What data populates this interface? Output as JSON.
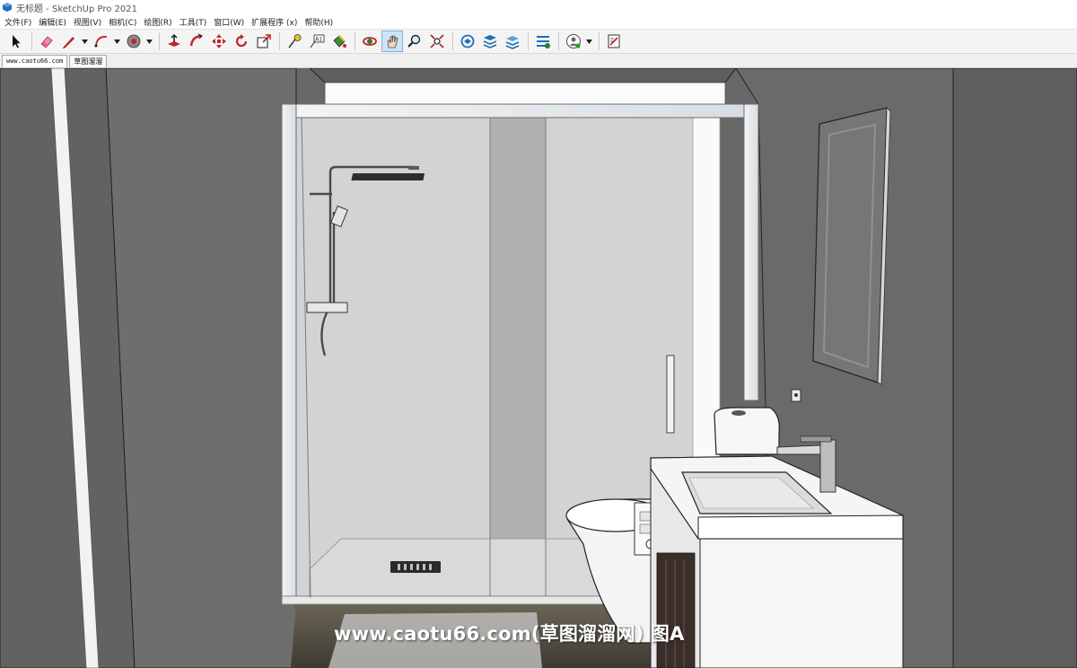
{
  "window": {
    "title": "无标题 - SketchUp Pro 2021"
  },
  "menu": {
    "items": [
      {
        "label": "文件(F)"
      },
      {
        "label": "编辑(E)"
      },
      {
        "label": "视图(V)"
      },
      {
        "label": "相机(C)"
      },
      {
        "label": "绘图(R)"
      },
      {
        "label": "工具(T)"
      },
      {
        "label": "窗口(W)"
      },
      {
        "label": "扩展程序 (x)"
      },
      {
        "label": "帮助(H)"
      }
    ]
  },
  "toolbar": {
    "tools": [
      {
        "icon": "select-arrow-icon"
      },
      {
        "icon": "eraser-icon"
      },
      {
        "icon": "pencil-line-icon"
      },
      {
        "icon": "arc-icon"
      },
      {
        "icon": "paint-bucket-icon"
      },
      {
        "icon": "push-pull-icon"
      },
      {
        "icon": "follow-me-icon"
      },
      {
        "icon": "move-icon"
      },
      {
        "icon": "rotate-icon"
      },
      {
        "icon": "scale-icon"
      },
      {
        "icon": "tape-measure-icon"
      },
      {
        "icon": "text-label-icon"
      },
      {
        "icon": "paint-icon"
      },
      {
        "icon": "orbit-icon"
      },
      {
        "icon": "pan-hand-icon"
      },
      {
        "icon": "zoom-icon"
      },
      {
        "icon": "zoom-extents-icon"
      },
      {
        "icon": "warehouse-icon"
      },
      {
        "icon": "extension-warehouse-icon"
      },
      {
        "icon": "layout-icon"
      },
      {
        "icon": "extension-manager-icon"
      },
      {
        "icon": "user-account-icon"
      },
      {
        "icon": "send-to-layout-icon"
      }
    ],
    "active_tool": "pan-hand-icon"
  },
  "scene_tabs": [
    {
      "label": "www.caotu66.com"
    },
    {
      "label": "草图溜溜"
    }
  ],
  "viewport": {
    "watermark": "www.caotu66.com(草图溜溜网) 图A"
  },
  "colors": {
    "wall": "#6a6a6a",
    "shower_panel": "#d2d2d2",
    "frame": "#e8edf0",
    "active_tool_bg": "#cde3f7",
    "accent_red": "#c0262c"
  }
}
